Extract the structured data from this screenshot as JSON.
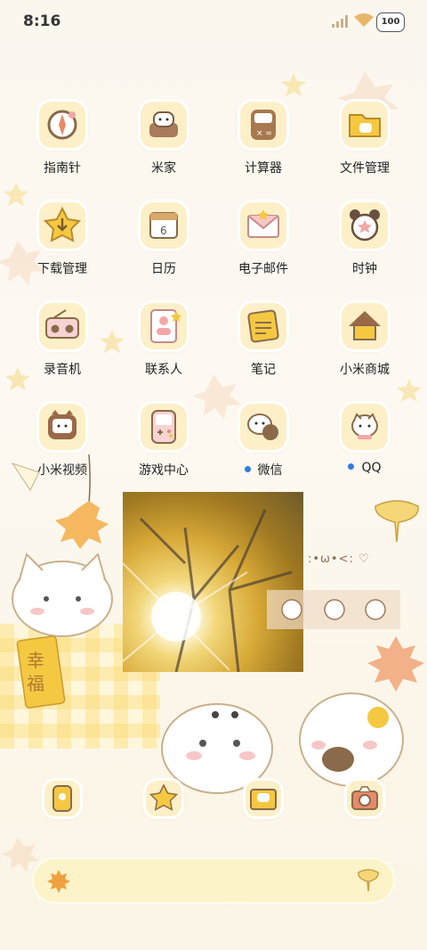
{
  "status_bar": {
    "time": "8:16",
    "battery": "100"
  },
  "apps": [
    {
      "label": "指南针",
      "icon": "compass-icon"
    },
    {
      "label": "米家",
      "icon": "home-sofa-icon"
    },
    {
      "label": "计算器",
      "icon": "calculator-icon"
    },
    {
      "label": "文件管理",
      "icon": "folder-icon"
    },
    {
      "label": "下载管理",
      "icon": "download-star-icon"
    },
    {
      "label": "日历",
      "icon": "calendar-icon",
      "day": "6"
    },
    {
      "label": "电子邮件",
      "icon": "mail-icon"
    },
    {
      "label": "时钟",
      "icon": "clock-icon"
    },
    {
      "label": "录音机",
      "icon": "radio-recorder-icon"
    },
    {
      "label": "联系人",
      "icon": "contacts-icon"
    },
    {
      "label": "笔记",
      "icon": "notes-icon"
    },
    {
      "label": "小米商城",
      "icon": "store-house-icon"
    },
    {
      "label": "小米视频",
      "icon": "tv-icon"
    },
    {
      "label": "游戏中心",
      "icon": "game-console-icon"
    },
    {
      "label": "微信",
      "icon": "wechat-icon",
      "new_dot": true
    },
    {
      "label": "QQ",
      "icon": "qq-icon",
      "new_dot": true
    }
  ],
  "widget": {
    "charm_text": "幸福",
    "kaomoji": ":•ω•<: ♡"
  },
  "dock": [
    {
      "icon": "phone-icon"
    },
    {
      "icon": "messages-star-icon"
    },
    {
      "icon": "gallery-icon"
    },
    {
      "icon": "camera-icon"
    }
  ],
  "search_bar": {
    "left_icon": "maple-leaf-icon",
    "right_icon": "ginkgo-leaf-icon"
  },
  "colors": {
    "accent": "#f5c842",
    "icon_bg": "#fdf0c8",
    "dot": "#2f7de1"
  }
}
